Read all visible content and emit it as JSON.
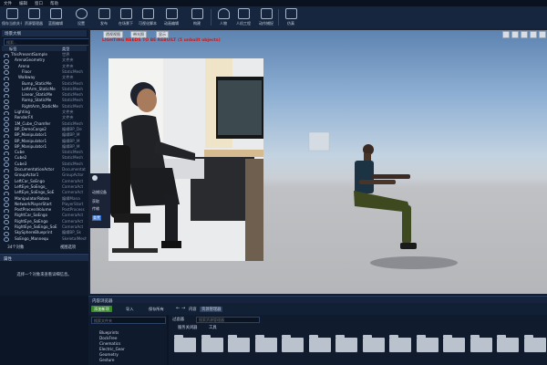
{
  "menu": [
    "文件",
    "编辑",
    "窗口",
    "帮助"
  ],
  "toolbar": [
    {
      "label": "保存当前关卡",
      "icon": "save-icon"
    },
    {
      "label": "资源管理器",
      "icon": "folder-icon"
    },
    {
      "label": "蓝图编辑",
      "icon": "blueprint-icon"
    },
    {
      "label": "设置",
      "icon": "gear-icon"
    },
    {
      "label": "发布",
      "icon": "package-icon"
    },
    {
      "label": "在场景下",
      "icon": "clap-icon"
    },
    {
      "label": "可视化脚本",
      "icon": "script-icon"
    },
    {
      "label": "动画编辑",
      "icon": "film-icon"
    },
    {
      "label": "构建",
      "icon": "build-icon"
    },
    {
      "label": "人物",
      "icon": "person-icon"
    },
    {
      "label": "人机工程",
      "icon": "ergonomics-icon"
    },
    {
      "label": "动作捕捉",
      "icon": "motion-icon"
    },
    {
      "label": "仿真",
      "icon": "play-icon"
    }
  ],
  "outliner": {
    "tab": "场景大纲",
    "search_placeholder": "搜索...",
    "col_label": "标签",
    "col_type": "类型",
    "rows": [
      {
        "name": "ThisPresentSample",
        "type": "世界",
        "indent": 0
      },
      {
        "name": "ArenaGeometry",
        "type": "文件夹",
        "indent": 1
      },
      {
        "name": "Arena",
        "type": "文件夹",
        "indent": 2
      },
      {
        "name": "Floor",
        "type": "StaticMesh",
        "indent": 3
      },
      {
        "name": "Walkway",
        "type": "文件夹",
        "indent": 2
      },
      {
        "name": "Bump_StaticMe",
        "type": "StaticMesh",
        "indent": 3
      },
      {
        "name": "LeftArm_StaticMe",
        "type": "StaticMesh",
        "indent": 3
      },
      {
        "name": "Linear_StaticMe",
        "type": "StaticMesh",
        "indent": 3
      },
      {
        "name": "Ramp_StaticMe",
        "type": "StaticMesh",
        "indent": 3
      },
      {
        "name": "RightArm_StaticMe",
        "type": "StaticMesh",
        "indent": 3
      },
      {
        "name": "Lighting",
        "type": "文件夹",
        "indent": 1
      },
      {
        "name": "RenderFX",
        "type": "文件夹",
        "indent": 1
      },
      {
        "name": "1M_Cube_Chamfer",
        "type": "StaticMesh",
        "indent": 1
      },
      {
        "name": "BP_DemoCargo2",
        "type": "编辑BP_De",
        "indent": 1
      },
      {
        "name": "BP_Manipulator1",
        "type": "编辑BP_M",
        "indent": 1
      },
      {
        "name": "BP_Manipulator1",
        "type": "编辑BP_M",
        "indent": 1
      },
      {
        "name": "BP_Manipulator1",
        "type": "编辑BP_M",
        "indent": 1
      },
      {
        "name": "Cube",
        "type": "StaticMesh",
        "indent": 1
      },
      {
        "name": "Cube2",
        "type": "StaticMesh",
        "indent": 1
      },
      {
        "name": "Cube3",
        "type": "StaticMesh",
        "indent": 1
      },
      {
        "name": "DocumentationActor",
        "type": "Documentat",
        "indent": 1
      },
      {
        "name": "GroupActor1",
        "type": "GroupActor",
        "indent": 1
      },
      {
        "name": "LeftCar_SoEngo",
        "type": "CameraAct",
        "indent": 1
      },
      {
        "name": "LeftEye_SoEngo_",
        "type": "CameraAct",
        "indent": 1
      },
      {
        "name": "LeftEye_SoEngo_SoE",
        "type": "CameraAct",
        "indent": 1
      },
      {
        "name": "ManipulatorRoboo",
        "type": "编辑Mana",
        "indent": 1
      },
      {
        "name": "NetworkPlayerStart",
        "type": "PlayerStart",
        "indent": 1
      },
      {
        "name": "PostProcessVolume",
        "type": "PostProcess",
        "indent": 1
      },
      {
        "name": "RightCar_SoEngo",
        "type": "CameraAct",
        "indent": 1
      },
      {
        "name": "RightEye_SoEngo",
        "type": "CameraAct",
        "indent": 1
      },
      {
        "name": "RightEye_SoEngo_SoE",
        "type": "CameraAct",
        "indent": 1
      },
      {
        "name": "SkySphereBlueprint",
        "type": "编辑BP_Sk",
        "indent": 1
      },
      {
        "name": "SoEngo_Mannequ",
        "type": "SkeletalMesh",
        "indent": 1
      }
    ],
    "count": "34个对象",
    "view_options": "视图选项"
  },
  "details": {
    "tab": "属性",
    "empty_text": "选择一个对象来查看详细信息。"
  },
  "viewport": {
    "mode_buttons": [
      "透视视图",
      "带光照",
      "显示"
    ],
    "warning": "LIGHTING NEEDS TO BE REBUILT (5 unbuilt objects)",
    "overlay_items": [
      "动捕设备",
      "获取",
      "传输",
      "重置"
    ]
  },
  "content_browser": {
    "tab": "内容浏览器",
    "add_new": "添加新项",
    "import": "导入",
    "save_all": "保存所有",
    "search_placeholder": "搜索文件夹",
    "path_root": "内容",
    "path_active": "资源管理器",
    "filter_label": "过滤器",
    "filter_search": "搜索资源管理器",
    "subtabs": [
      "服务关闭器",
      "工具"
    ],
    "tree": [
      "Blueprints",
      "DockFree",
      "Cinematics",
      "Electric_Gear",
      "Geometry",
      "Gesture"
    ],
    "folder_count": 14
  },
  "colors": {
    "accent": "#3d8bff",
    "warning": "#d01818",
    "add_new_green": "#3c8a2e"
  }
}
